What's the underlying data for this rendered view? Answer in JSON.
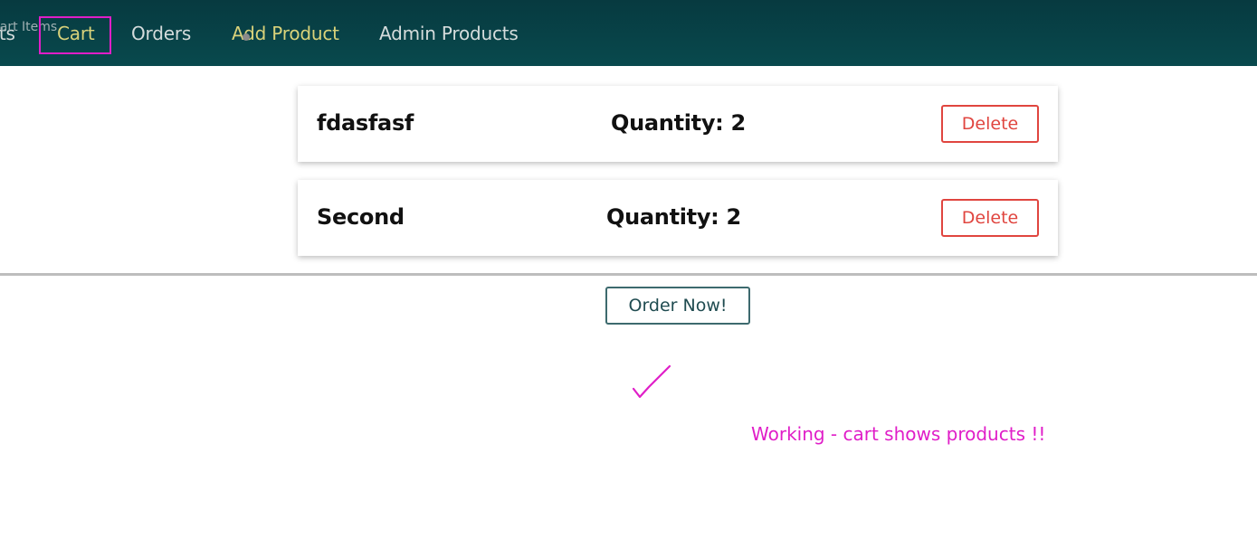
{
  "nav": {
    "tooltip": "Cart Items",
    "items": [
      {
        "label": "Products"
      },
      {
        "label": "Cart"
      },
      {
        "label": "Orders"
      },
      {
        "label": "Add Product"
      },
      {
        "label": "Admin Products"
      }
    ]
  },
  "cart": {
    "items": [
      {
        "title": "fdasfasf",
        "quantity": "Quantity: 2",
        "delete_label": "Delete"
      },
      {
        "title": "Second",
        "quantity": "Quantity: 2",
        "delete_label": "Delete"
      }
    ],
    "order_label": "Order Now!"
  },
  "annotation": {
    "text": "Working - cart shows products !!"
  },
  "colors": {
    "header": "#08494d",
    "active_nav": "#d9d27a",
    "delete": "#e0453f",
    "annotation": "#e01ec8"
  }
}
